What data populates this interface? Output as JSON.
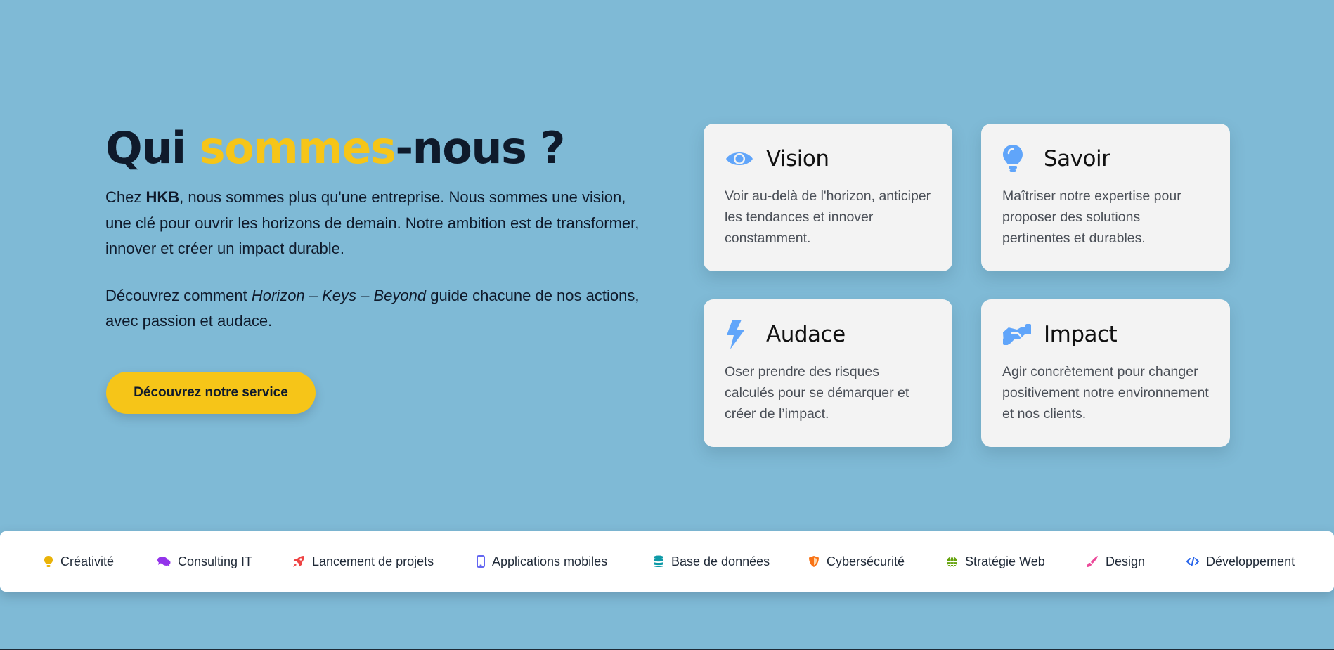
{
  "hero": {
    "title_before": "Qui ",
    "title_accent": "sommes",
    "title_after": "-nous ?",
    "p1_before": "Chez ",
    "p1_bold": "HKB",
    "p1_after": ", nous sommes plus qu'une entreprise. Nous sommes une vision, une clé pour ouvrir les horizons de demain. Notre ambition est de transformer, innover et créer un impact durable.",
    "p2_before": "Découvrez comment ",
    "p2_italic": "Horizon – Keys – Beyond",
    "p2_after": " guide chacune de nos actions, avec passion et audace.",
    "cta_label": "Découvrez notre service"
  },
  "cards": [
    {
      "title": "Vision",
      "icon": "eye-icon",
      "desc": "Voir au-delà de l'horizon, anticiper les tendances et innover constamment."
    },
    {
      "title": "Savoir",
      "icon": "lightbulb-icon",
      "desc": "Maîtriser notre expertise pour proposer des solutions pertinentes et durables."
    },
    {
      "title": "Audace",
      "icon": "bolt-icon",
      "desc": "Oser prendre des risques calculés pour se démarquer et créer de l’impact."
    },
    {
      "title": "Impact",
      "icon": "handshake-icon",
      "desc": "Agir concrètement pour changer positivement notre environnement et nos clients."
    }
  ],
  "services": [
    {
      "label": "Créativité",
      "icon": "lightbulb-icon",
      "color": "#eab308"
    },
    {
      "label": "Consulting IT",
      "icon": "comments-icon",
      "color": "#9333ea"
    },
    {
      "label": "Lancement de projets",
      "icon": "rocket-icon",
      "color": "#ef4444"
    },
    {
      "label": "Applications mobiles",
      "icon": "mobile-icon",
      "color": "#6366f1"
    },
    {
      "label": "Base de données",
      "icon": "database-icon",
      "color": "#0e9aa7"
    },
    {
      "label": "Cybersécurité",
      "icon": "shield-icon",
      "color": "#f97316"
    },
    {
      "label": "Stratégie Web",
      "icon": "globe-icon",
      "color": "#65a30d"
    },
    {
      "label": "Design",
      "icon": "paintbrush-icon",
      "color": "#ec4899"
    },
    {
      "label": "Développement",
      "icon": "code-icon",
      "color": "#2563eb"
    }
  ],
  "colors": {
    "background": "#7fbad6",
    "accent": "#f6c518",
    "card_icon": "#60a5fa",
    "heading": "#0f1a2b"
  }
}
